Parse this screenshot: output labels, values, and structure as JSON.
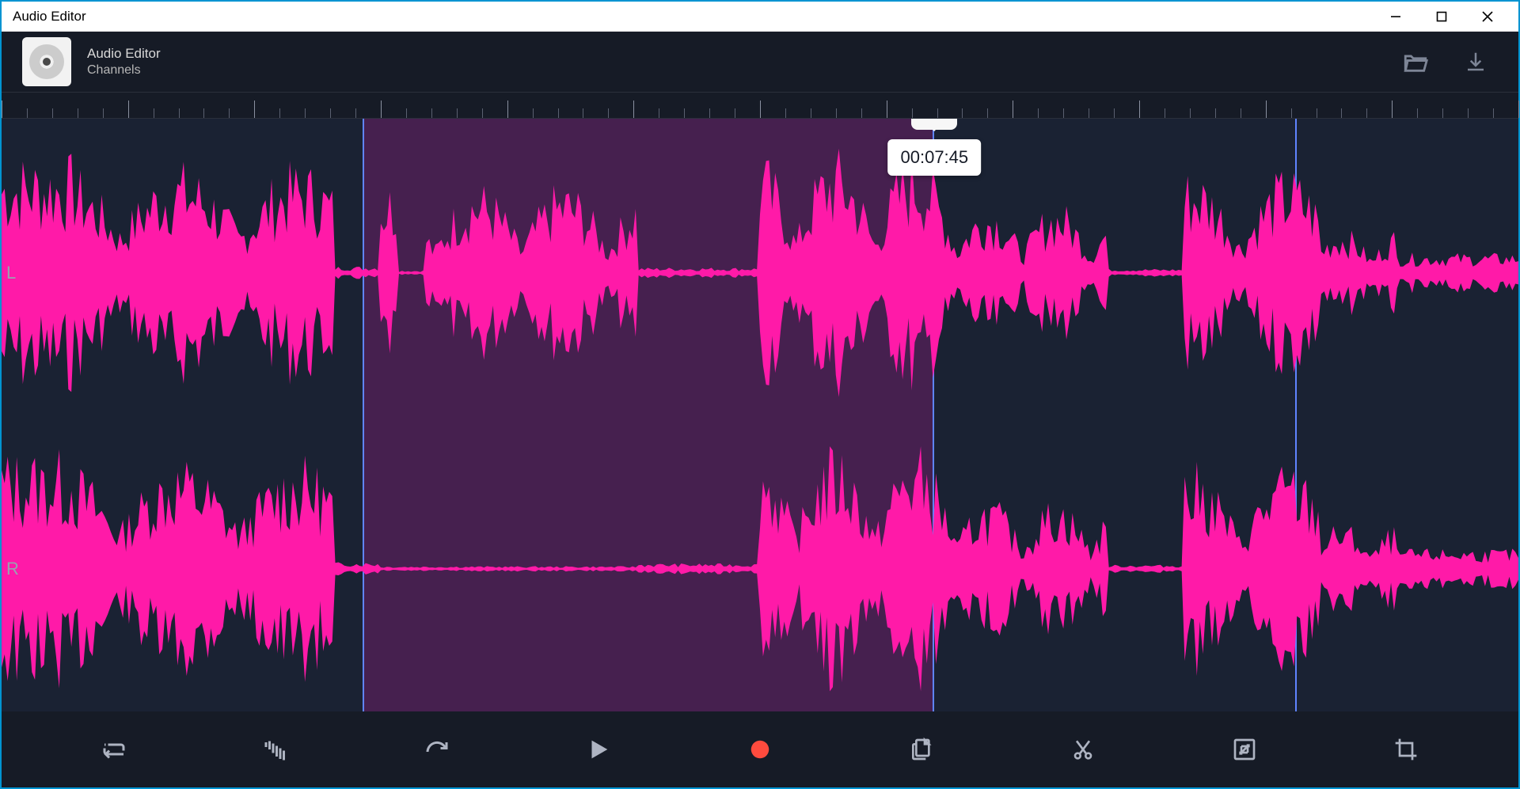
{
  "window": {
    "title": "Audio Editor"
  },
  "header": {
    "app_name": "Audio Editor",
    "subtitle": "Channels"
  },
  "channels": {
    "left_label": "L",
    "right_label": "R"
  },
  "playhead": {
    "timecode": "00:07:45",
    "position_pct": 61.5
  },
  "selection": {
    "start_pct": 23.8,
    "end_pct": 61.5
  },
  "marker_right_pct": 85.3,
  "toolbar": {
    "repeat": "repeat",
    "fade": "fade",
    "redo": "redo",
    "play": "play",
    "record": "record",
    "copy": "copy",
    "cut": "cut",
    "resize": "resize",
    "crop": "crop"
  }
}
